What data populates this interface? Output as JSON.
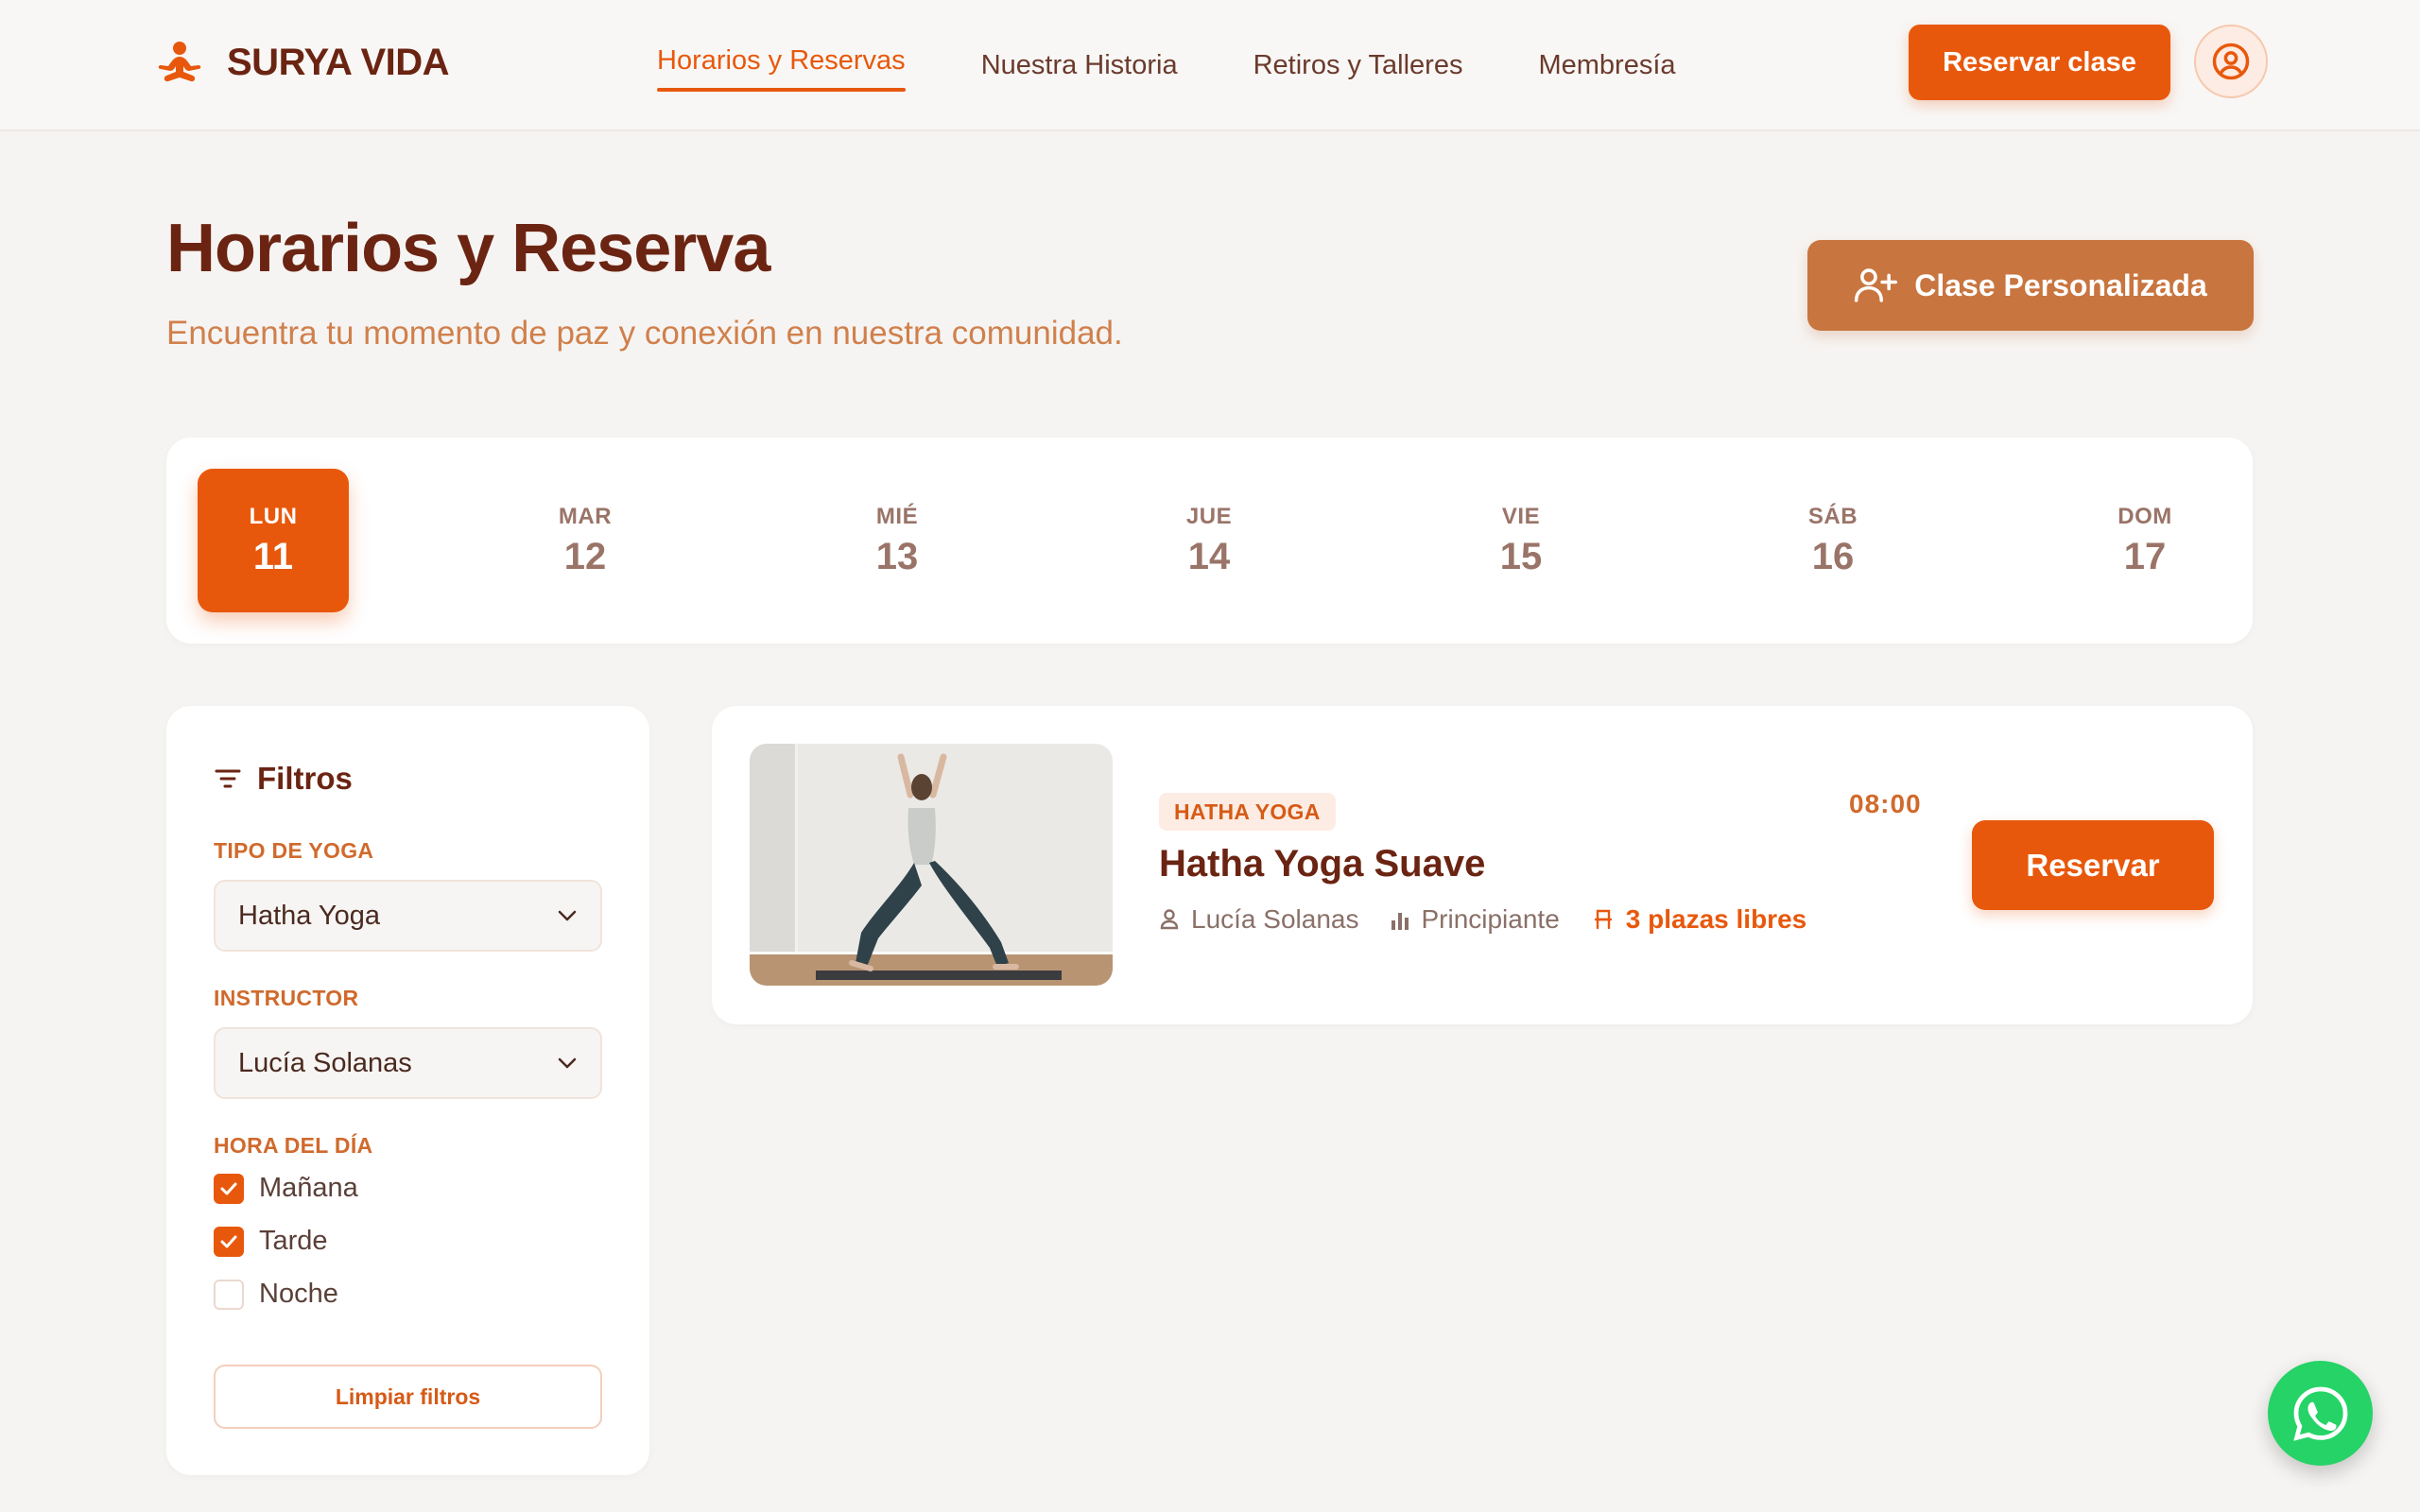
{
  "header": {
    "brand": "SURYA VIDA",
    "nav": [
      {
        "label": "Horarios y Reservas",
        "active": true
      },
      {
        "label": "Nuestra Historia",
        "active": false
      },
      {
        "label": "Retiros y Talleres",
        "active": false
      },
      {
        "label": "Membresía",
        "active": false
      }
    ],
    "book_label": "Reservar clase",
    "user_icon": "user-circle-icon"
  },
  "page": {
    "title": "Horarios y Reserva",
    "subtitle": "Encuentra tu momento de paz y conexión en nuestra comunidad.",
    "custom_class_label": "Clase Personalizada"
  },
  "days": [
    {
      "name": "LUN",
      "num": "11",
      "selected": true
    },
    {
      "name": "MAR",
      "num": "12",
      "selected": false
    },
    {
      "name": "MIÉ",
      "num": "13",
      "selected": false
    },
    {
      "name": "JUE",
      "num": "14",
      "selected": false
    },
    {
      "name": "VIE",
      "num": "15",
      "selected": false
    },
    {
      "name": "SÁB",
      "num": "16",
      "selected": false
    },
    {
      "name": "DOM",
      "num": "17",
      "selected": false
    }
  ],
  "filters": {
    "title": "Filtros",
    "type_label": "TIPO DE YOGA",
    "type_value": "Hatha Yoga",
    "instructor_label": "INSTRUCTOR",
    "instructor_value": "Lucía Solanas",
    "time_label": "HORA DEL DÍA",
    "times": [
      {
        "label": "Mañana",
        "checked": true
      },
      {
        "label": "Tarde",
        "checked": true
      },
      {
        "label": "Noche",
        "checked": false
      }
    ],
    "clear_label": "Limpiar filtros"
  },
  "class_card": {
    "tag": "HATHA YOGA",
    "time": "08:00",
    "title": "Hatha Yoga Suave",
    "instructor": "Lucía Solanas",
    "level": "Principiante",
    "spots": "3 plazas libres",
    "reserve_label": "Reservar"
  },
  "colors": {
    "accent": "#e8580c",
    "secondary": "#c8753f",
    "heading": "#6b2412",
    "whatsapp": "#25d366"
  }
}
